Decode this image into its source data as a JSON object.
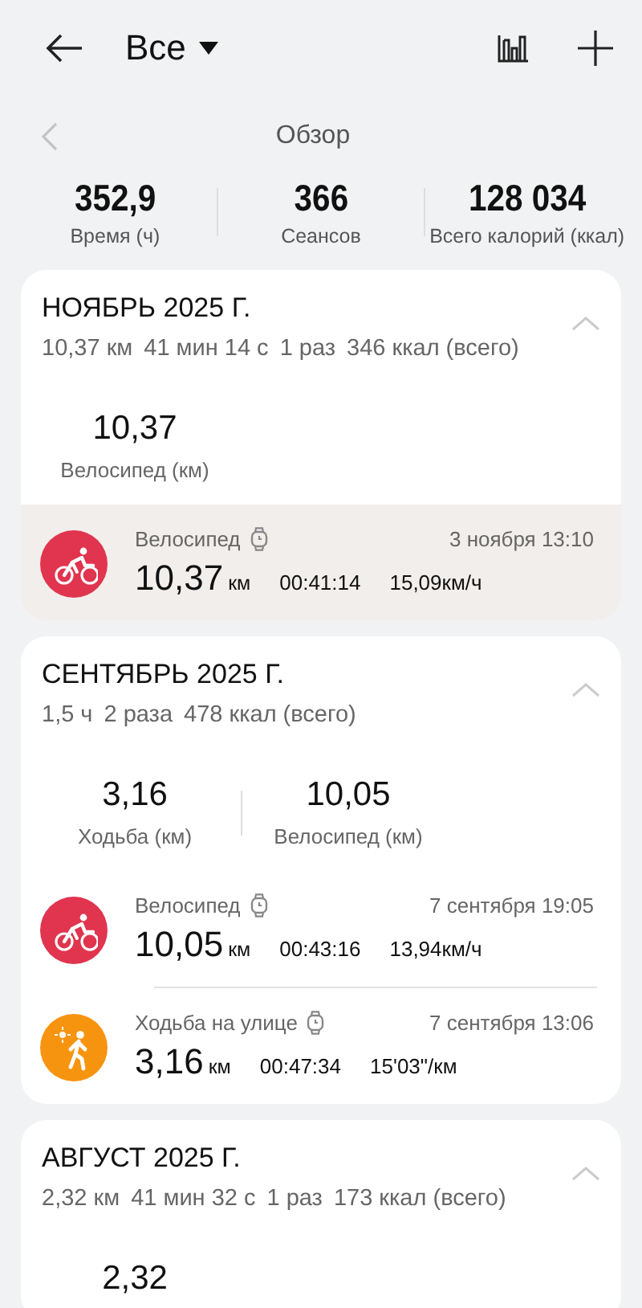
{
  "header": {
    "filter": "Все"
  },
  "overview": {
    "title": "Обзор",
    "prev_disabled": true
  },
  "stats": [
    {
      "value": "352,9",
      "label": "Время (ч)"
    },
    {
      "value": "366",
      "label": "Сеансов"
    },
    {
      "value": "128 034",
      "label": "Всего калорий (ккал)"
    }
  ],
  "months": [
    {
      "title": "НОЯБРЬ 2025 Г.",
      "expanded": true,
      "summary": [
        "10,37 км",
        "41 мин 14 с",
        "1 раз",
        "346 ккал (всего)"
      ],
      "totals": [
        {
          "value": "10,37",
          "label": "Велосипед (км)"
        }
      ],
      "workouts": [
        {
          "kind": "cycling",
          "color": "#e0344f",
          "selected": true,
          "name": "Велосипед",
          "date": "3 ноября 13:10",
          "distance": "10,37",
          "unit": "км",
          "duration": "00:41:14",
          "pace": "15,09км/ч"
        }
      ]
    },
    {
      "title": "СЕНТЯБРЬ 2025 Г.",
      "expanded": true,
      "summary": [
        "1,5 ч",
        "2 раза",
        "478 ккал (всего)"
      ],
      "totals": [
        {
          "value": "3,16",
          "label": "Ходьба (км)"
        },
        {
          "value": "10,05",
          "label": "Велосипед (км)"
        }
      ],
      "workouts": [
        {
          "kind": "cycling",
          "color": "#e0344f",
          "selected": false,
          "name": "Велосипед",
          "date": "7 сентября 19:05",
          "distance": "10,05",
          "unit": "км",
          "duration": "00:43:16",
          "pace": "13,94км/ч"
        },
        {
          "kind": "walking",
          "color": "#f7940f",
          "selected": false,
          "name": "Ходьба на улице",
          "date": "7 сентября 13:06",
          "distance": "3,16",
          "unit": "км",
          "duration": "00:47:34",
          "pace": "15'03\"/км"
        }
      ]
    },
    {
      "title": "АВГУСТ 2025 Г.",
      "expanded": true,
      "summary": [
        "2,32 км",
        "41 мин 32 с",
        "1 раз",
        "173 ккал (всего)"
      ],
      "totals": [
        {
          "value": "2,32"
        }
      ]
    }
  ]
}
